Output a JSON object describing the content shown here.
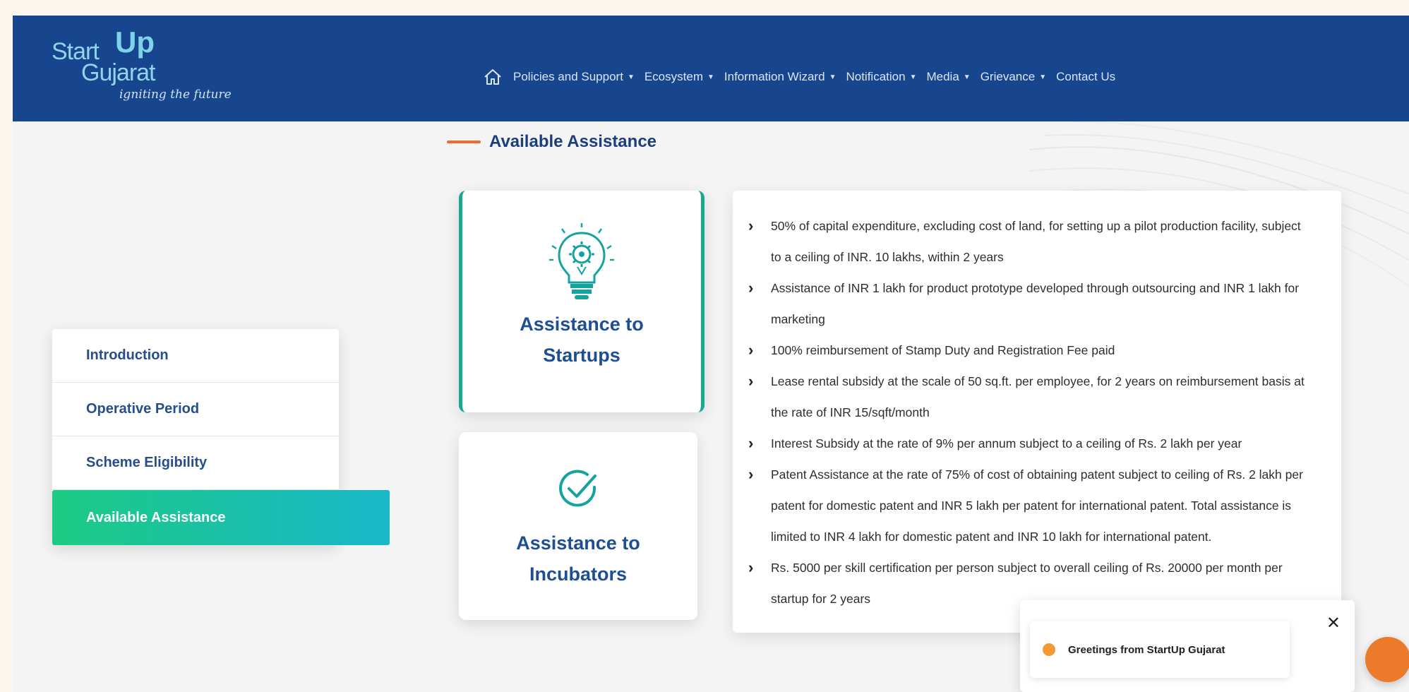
{
  "header": {
    "logo": {
      "start": "Start",
      "up": "Up",
      "gujarat": "Gujarat",
      "tagline": "igniting the future"
    },
    "nav": [
      {
        "label": "Policies and Support",
        "has_dropdown": true
      },
      {
        "label": "Ecosystem",
        "has_dropdown": true
      },
      {
        "label": "Information Wizard",
        "has_dropdown": true
      },
      {
        "label": "Notification",
        "has_dropdown": true
      },
      {
        "label": "Media",
        "has_dropdown": true
      },
      {
        "label": "Grievance",
        "has_dropdown": true
      },
      {
        "label": "Contact Us",
        "has_dropdown": false
      }
    ],
    "home_icon": "home-icon",
    "bg_color": "#17468f"
  },
  "section_title": "Available Assistance",
  "sidebar": {
    "items": [
      {
        "label": "Introduction",
        "active": false
      },
      {
        "label": "Operative Period",
        "active": false
      },
      {
        "label": "Scheme Eligibility",
        "active": false
      },
      {
        "label": "Available Assistance",
        "active": true
      }
    ],
    "active_color": "#1ccb83"
  },
  "cards": {
    "startups": {
      "line1": "Assistance to",
      "line2": "Startups",
      "icon": "lightbulb-gear-icon",
      "selected": true
    },
    "incubators": {
      "line1": "Assistance to",
      "line2": "Incubators",
      "icon": "check-circle-icon",
      "selected": false
    }
  },
  "details": [
    "50% of capital expenditure, excluding cost of land, for setting up a pilot production facility, subject to a ceiling of INR. 10 lakhs, within 2 years",
    "Assistance of INR 1 lakh for product prototype developed through outsourcing and INR 1 lakh for marketing",
    "100% reimbursement of Stamp Duty and Registration Fee paid",
    "Lease rental subsidy at the scale of 50 sq.ft. per employee, for 2 years on reimbursement basis at the rate of INR 15/sqft/month",
    "Interest Subsidy at the rate of 9% per annum subject to a ceiling of Rs. 2 lakh per year",
    "Patent Assistance at the rate of 75% of cost of obtaining patent subject to ceiling of Rs. 2 lakh per patent for domestic patent and INR 5 lakh per patent for international patent. Total assistance is limited to INR 4 lakh for domestic patent and INR 10 lakh for international patent.",
    "Rs. 5000 per skill certification per person subject to overall ceiling of Rs. 20000 per month per startup for 2 years"
  ],
  "chat": {
    "message": "Greetings from StartUp Gujarat",
    "close_icon": "close-icon"
  },
  "colors": {
    "accent_orange": "#ef6a2e",
    "title_blue": "#1b3f7c",
    "card_border_teal": "#17a88e"
  }
}
